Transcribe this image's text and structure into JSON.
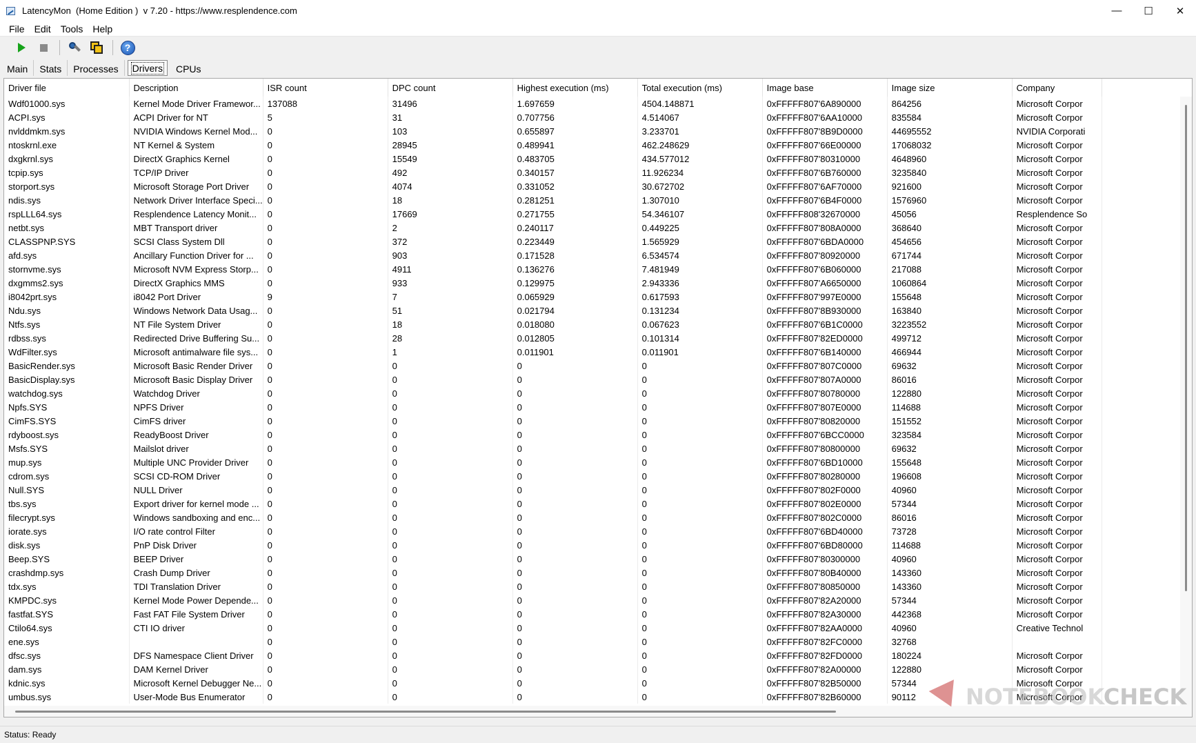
{
  "window": {
    "title": "LatencyMon  (Home Edition )  v 7.20 - https://www.resplendence.com",
    "minimize_glyph": "—",
    "maximize_glyph": "☐",
    "close_glyph": "✕"
  },
  "menu": [
    "File",
    "Edit",
    "Tools",
    "Help"
  ],
  "toolbar": {
    "icons": [
      "play-icon",
      "stop-icon",
      "wrench-icon",
      "copy-icon",
      "help-icon"
    ],
    "help_glyph": "?"
  },
  "tabs": {
    "items": [
      "Main",
      "Stats",
      "Processes",
      "Drivers",
      "CPUs"
    ],
    "active": "Drivers"
  },
  "table": {
    "columns": [
      "Driver file",
      "Description",
      "ISR count",
      "DPC count",
      "Highest execution (ms)",
      "Total execution (ms)",
      "Image base",
      "Image size",
      "Company"
    ],
    "rows": [
      [
        "Wdf01000.sys",
        "Kernel Mode Driver Framewor...",
        "137088",
        "31496",
        "1.697659",
        "4504.148871",
        "0xFFFFF807'6A890000",
        "864256",
        "Microsoft Corpor"
      ],
      [
        "ACPI.sys",
        "ACPI Driver for NT",
        "5",
        "31",
        "0.707756",
        "4.514067",
        "0xFFFFF807'6AA10000",
        "835584",
        "Microsoft Corpor"
      ],
      [
        "nvlddmkm.sys",
        "NVIDIA Windows Kernel Mod...",
        "0",
        "103",
        "0.655897",
        "3.233701",
        "0xFFFFF807'8B9D0000",
        "44695552",
        "NVIDIA Corporati"
      ],
      [
        "ntoskrnl.exe",
        "NT Kernel & System",
        "0",
        "28945",
        "0.489941",
        "462.248629",
        "0xFFFFF807'66E00000",
        "17068032",
        "Microsoft Corpor"
      ],
      [
        "dxgkrnl.sys",
        "DirectX Graphics Kernel",
        "0",
        "15549",
        "0.483705",
        "434.577012",
        "0xFFFFF807'80310000",
        "4648960",
        "Microsoft Corpor"
      ],
      [
        "tcpip.sys",
        "TCP/IP Driver",
        "0",
        "492",
        "0.340157",
        "11.926234",
        "0xFFFFF807'6B760000",
        "3235840",
        "Microsoft Corpor"
      ],
      [
        "storport.sys",
        "Microsoft Storage Port Driver",
        "0",
        "4074",
        "0.331052",
        "30.672702",
        "0xFFFFF807'6AF70000",
        "921600",
        "Microsoft Corpor"
      ],
      [
        "ndis.sys",
        "Network Driver Interface Speci...",
        "0",
        "18",
        "0.281251",
        "1.307010",
        "0xFFFFF807'6B4F0000",
        "1576960",
        "Microsoft Corpor"
      ],
      [
        "rspLLL64.sys",
        "Resplendence Latency Monit...",
        "0",
        "17669",
        "0.271755",
        "54.346107",
        "0xFFFFF808'32670000",
        "45056",
        "Resplendence So"
      ],
      [
        "netbt.sys",
        "MBT Transport driver",
        "0",
        "2",
        "0.240117",
        "0.449225",
        "0xFFFFF807'808A0000",
        "368640",
        "Microsoft Corpor"
      ],
      [
        "CLASSPNP.SYS",
        "SCSI Class System Dll",
        "0",
        "372",
        "0.223449",
        "1.565929",
        "0xFFFFF807'6BDA0000",
        "454656",
        "Microsoft Corpor"
      ],
      [
        "afd.sys",
        "Ancillary Function Driver for ...",
        "0",
        "903",
        "0.171528",
        "6.534574",
        "0xFFFFF807'80920000",
        "671744",
        "Microsoft Corpor"
      ],
      [
        "stornvme.sys",
        "Microsoft NVM Express Storp...",
        "0",
        "4911",
        "0.136276",
        "7.481949",
        "0xFFFFF807'6B060000",
        "217088",
        "Microsoft Corpor"
      ],
      [
        "dxgmms2.sys",
        "DirectX Graphics MMS",
        "0",
        "933",
        "0.129975",
        "2.943336",
        "0xFFFFF807'A6650000",
        "1060864",
        "Microsoft Corpor"
      ],
      [
        "i8042prt.sys",
        "i8042 Port Driver",
        "9",
        "7",
        "0.065929",
        "0.617593",
        "0xFFFFF807'997E0000",
        "155648",
        "Microsoft Corpor"
      ],
      [
        "Ndu.sys",
        "Windows Network Data Usag...",
        "0",
        "51",
        "0.021794",
        "0.131234",
        "0xFFFFF807'8B930000",
        "163840",
        "Microsoft Corpor"
      ],
      [
        "Ntfs.sys",
        "NT File System Driver",
        "0",
        "18",
        "0.018080",
        "0.067623",
        "0xFFFFF807'6B1C0000",
        "3223552",
        "Microsoft Corpor"
      ],
      [
        "rdbss.sys",
        "Redirected Drive Buffering Su...",
        "0",
        "28",
        "0.012805",
        "0.101314",
        "0xFFFFF807'82ED0000",
        "499712",
        "Microsoft Corpor"
      ],
      [
        "WdFilter.sys",
        "Microsoft antimalware file sys...",
        "0",
        "1",
        "0.011901",
        "0.011901",
        "0xFFFFF807'6B140000",
        "466944",
        "Microsoft Corpor"
      ],
      [
        "BasicRender.sys",
        "Microsoft Basic Render Driver",
        "0",
        "0",
        "0",
        "0",
        "0xFFFFF807'807C0000",
        "69632",
        "Microsoft Corpor"
      ],
      [
        "BasicDisplay.sys",
        "Microsoft Basic Display Driver",
        "0",
        "0",
        "0",
        "0",
        "0xFFFFF807'807A0000",
        "86016",
        "Microsoft Corpor"
      ],
      [
        "watchdog.sys",
        "Watchdog Driver",
        "0",
        "0",
        "0",
        "0",
        "0xFFFFF807'80780000",
        "122880",
        "Microsoft Corpor"
      ],
      [
        "Npfs.SYS",
        "NPFS Driver",
        "0",
        "0",
        "0",
        "0",
        "0xFFFFF807'807E0000",
        "114688",
        "Microsoft Corpor"
      ],
      [
        "CimFS.SYS",
        "CimFS driver",
        "0",
        "0",
        "0",
        "0",
        "0xFFFFF807'80820000",
        "151552",
        "Microsoft Corpor"
      ],
      [
        "rdyboost.sys",
        "ReadyBoost Driver",
        "0",
        "0",
        "0",
        "0",
        "0xFFFFF807'6BCC0000",
        "323584",
        "Microsoft Corpor"
      ],
      [
        "Msfs.SYS",
        "Mailslot driver",
        "0",
        "0",
        "0",
        "0",
        "0xFFFFF807'80800000",
        "69632",
        "Microsoft Corpor"
      ],
      [
        "mup.sys",
        "Multiple UNC Provider Driver",
        "0",
        "0",
        "0",
        "0",
        "0xFFFFF807'6BD10000",
        "155648",
        "Microsoft Corpor"
      ],
      [
        "cdrom.sys",
        "SCSI CD-ROM Driver",
        "0",
        "0",
        "0",
        "0",
        "0xFFFFF807'80280000",
        "196608",
        "Microsoft Corpor"
      ],
      [
        "Null.SYS",
        "NULL Driver",
        "0",
        "0",
        "0",
        "0",
        "0xFFFFF807'802F0000",
        "40960",
        "Microsoft Corpor"
      ],
      [
        "tbs.sys",
        "Export driver for kernel mode ...",
        "0",
        "0",
        "0",
        "0",
        "0xFFFFF807'802E0000",
        "57344",
        "Microsoft Corpor"
      ],
      [
        "filecrypt.sys",
        "Windows sandboxing and enc...",
        "0",
        "0",
        "0",
        "0",
        "0xFFFFF807'802C0000",
        "86016",
        "Microsoft Corpor"
      ],
      [
        "iorate.sys",
        "I/O rate control Filter",
        "0",
        "0",
        "0",
        "0",
        "0xFFFFF807'6BD40000",
        "73728",
        "Microsoft Corpor"
      ],
      [
        "disk.sys",
        "PnP Disk Driver",
        "0",
        "0",
        "0",
        "0",
        "0xFFFFF807'6BD80000",
        "114688",
        "Microsoft Corpor"
      ],
      [
        "Beep.SYS",
        "BEEP Driver",
        "0",
        "0",
        "0",
        "0",
        "0xFFFFF807'80300000",
        "40960",
        "Microsoft Corpor"
      ],
      [
        "crashdmp.sys",
        "Crash Dump Driver",
        "0",
        "0",
        "0",
        "0",
        "0xFFFFF807'80B40000",
        "143360",
        "Microsoft Corpor"
      ],
      [
        "tdx.sys",
        "TDI Translation Driver",
        "0",
        "0",
        "0",
        "0",
        "0xFFFFF807'80850000",
        "143360",
        "Microsoft Corpor"
      ],
      [
        "KMPDC.sys",
        "Kernel Mode Power Depende...",
        "0",
        "0",
        "0",
        "0",
        "0xFFFFF807'82A20000",
        "57344",
        "Microsoft Corpor"
      ],
      [
        "fastfat.SYS",
        "Fast FAT File System Driver",
        "0",
        "0",
        "0",
        "0",
        "0xFFFFF807'82A30000",
        "442368",
        "Microsoft Corpor"
      ],
      [
        "Ctilo64.sys",
        "CTI IO driver",
        "0",
        "0",
        "0",
        "0",
        "0xFFFFF807'82AA0000",
        "40960",
        "Creative Technol"
      ],
      [
        "ene.sys",
        "",
        "0",
        "0",
        "0",
        "0",
        "0xFFFFF807'82FC0000",
        "32768",
        ""
      ],
      [
        "dfsc.sys",
        "DFS Namespace Client Driver",
        "0",
        "0",
        "0",
        "0",
        "0xFFFFF807'82FD0000",
        "180224",
        "Microsoft Corpor"
      ],
      [
        "dam.sys",
        "DAM Kernel Driver",
        "0",
        "0",
        "0",
        "0",
        "0xFFFFF807'82A00000",
        "122880",
        "Microsoft Corpor"
      ],
      [
        "kdnic.sys",
        "Microsoft Kernel Debugger Ne...",
        "0",
        "0",
        "0",
        "0",
        "0xFFFFF807'82B50000",
        "57344",
        "Microsoft Corpor"
      ],
      [
        "umbus.sys",
        "User-Mode Bus Enumerator",
        "0",
        "0",
        "0",
        "0",
        "0xFFFFF807'82B60000",
        "90112",
        "Microsoft Corpor"
      ]
    ]
  },
  "watermark": {
    "prefix": "NOTEBOOK",
    "suffix": "CHECK"
  },
  "status": "Status: Ready"
}
